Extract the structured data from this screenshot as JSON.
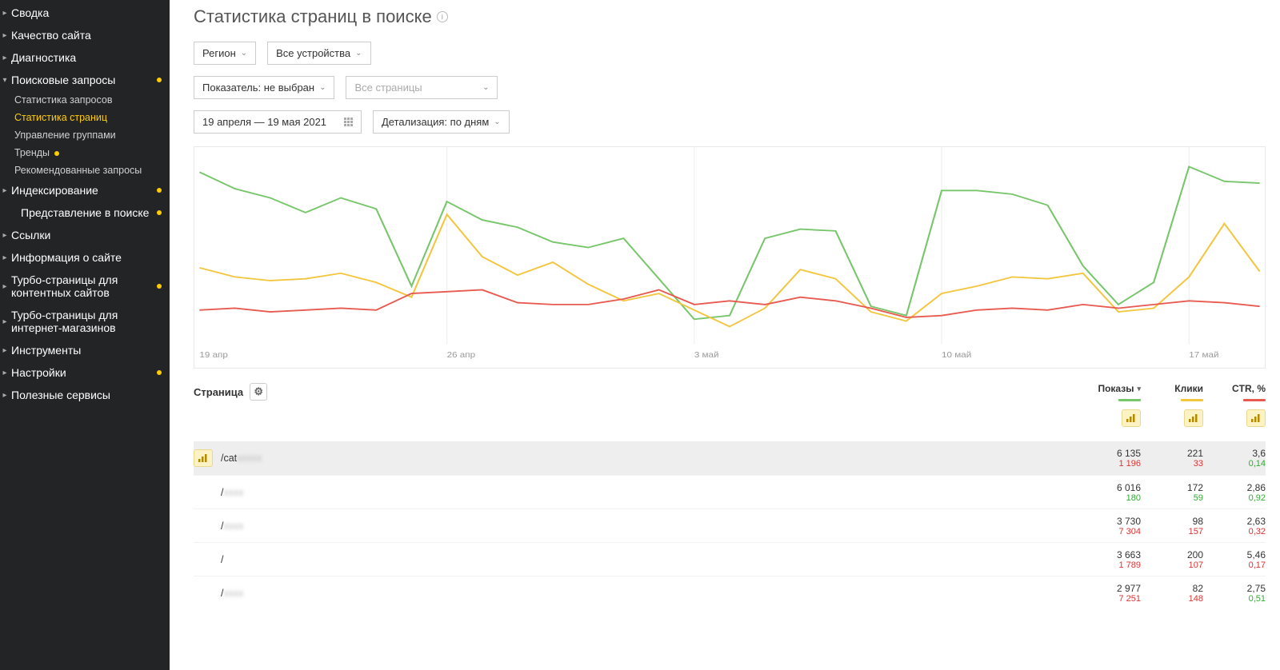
{
  "sidebar": {
    "items": [
      {
        "label": "Сводка",
        "caret": true
      },
      {
        "label": "Качество сайта",
        "caret": true
      },
      {
        "label": "Диагностика",
        "caret": true
      },
      {
        "label": "Поисковые запросы",
        "caret": true,
        "dot": true,
        "expanded": true,
        "children": [
          {
            "label": "Статистика запросов"
          },
          {
            "label": "Статистика страниц",
            "active": true
          },
          {
            "label": "Управление группами"
          },
          {
            "label": "Тренды",
            "dot": true
          },
          {
            "label": "Рекомендованные запросы"
          }
        ]
      },
      {
        "label": "Индексирование",
        "caret": true,
        "dot": true
      },
      {
        "label": "Представление в поиске",
        "caret": false,
        "dot": true,
        "indent": true
      },
      {
        "label": "Ссылки",
        "caret": true
      },
      {
        "label": "Информация о сайте",
        "caret": true
      },
      {
        "label": "Турбо-страницы для контентных сайтов",
        "caret": true,
        "dot": true
      },
      {
        "label": "Турбо-страницы для интернет-магазинов",
        "caret": true
      },
      {
        "label": "Инструменты",
        "caret": true
      },
      {
        "label": "Настройки",
        "caret": true,
        "dot": true
      },
      {
        "label": "Полезные сервисы",
        "caret": true
      }
    ]
  },
  "header": {
    "title": "Статистика страниц в поиске"
  },
  "controls": {
    "region": "Регион",
    "devices": "Все устройства",
    "metric": "Показатель: не выбран",
    "pages": "Все страницы",
    "date_range": "19 апреля — 19 мая 2021",
    "detail": "Детализация: по дням"
  },
  "chart_data": {
    "type": "line",
    "x_ticks": [
      "19 апр",
      "26 апр",
      "3 май",
      "10 май",
      "17 май"
    ],
    "x": [
      0,
      1,
      2,
      3,
      4,
      5,
      6,
      7,
      8,
      9,
      10,
      11,
      12,
      13,
      14,
      15,
      16,
      17,
      18,
      19,
      20,
      21,
      22,
      23,
      24,
      25,
      26,
      27,
      28,
      29,
      30
    ],
    "series": [
      {
        "name": "Показы",
        "color": "#78c66b",
        "values": [
          92,
          83,
          78,
          70,
          78,
          72,
          30,
          76,
          66,
          62,
          54,
          51,
          56,
          34,
          12,
          14,
          56,
          61,
          60,
          19,
          14,
          82,
          82,
          80,
          74,
          41,
          20,
          32,
          95,
          87,
          86
        ]
      },
      {
        "name": "Клики",
        "color": "#f3c63f",
        "values": [
          40,
          35,
          33,
          34,
          37,
          32,
          24,
          69,
          46,
          36,
          43,
          31,
          22,
          26,
          17,
          8,
          18,
          39,
          34,
          16,
          11,
          26,
          30,
          35,
          34,
          37,
          16,
          18,
          35,
          64,
          38
        ]
      },
      {
        "name": "CTR, %",
        "color": "#e85a4f",
        "values": [
          17,
          18,
          16,
          17,
          18,
          17,
          26,
          27,
          28,
          21,
          20,
          20,
          23,
          28,
          20,
          22,
          20,
          24,
          22,
          18,
          13,
          14,
          17,
          18,
          17,
          20,
          18,
          20,
          22,
          21,
          19
        ]
      }
    ],
    "y_range": [
      0,
      100
    ]
  },
  "table": {
    "header": {
      "page": "Страница",
      "cols": [
        {
          "label": "Показы",
          "sort": true,
          "underline": "#78c66b"
        },
        {
          "label": "Клики",
          "underline": "#f3c63f"
        },
        {
          "label": "CTR, %",
          "underline": "#e85a4f"
        }
      ]
    },
    "rows": [
      {
        "highlight": true,
        "url_prefix": "/cat",
        "url_blur": "xxxxx",
        "metrics": [
          {
            "main": "6 135",
            "delta": "1 196",
            "dir": "neg"
          },
          {
            "main": "221",
            "delta": "33",
            "dir": "neg"
          },
          {
            "main": "3,6",
            "delta": "0,14",
            "dir": "pos"
          }
        ]
      },
      {
        "url_prefix": "/",
        "url_blur": "xxxx",
        "metrics": [
          {
            "main": "6 016",
            "delta": "180",
            "dir": "pos"
          },
          {
            "main": "172",
            "delta": "59",
            "dir": "pos"
          },
          {
            "main": "2,86",
            "delta": "0,92",
            "dir": "pos"
          }
        ]
      },
      {
        "url_prefix": "/",
        "url_blur": "xxxx",
        "metrics": [
          {
            "main": "3 730",
            "delta": "7 304",
            "dir": "neg"
          },
          {
            "main": "98",
            "delta": "157",
            "dir": "neg"
          },
          {
            "main": "2,63",
            "delta": "0,32",
            "dir": "neg"
          }
        ]
      },
      {
        "url_prefix": "/",
        "url_blur": "",
        "metrics": [
          {
            "main": "3 663",
            "delta": "1 789",
            "dir": "neg"
          },
          {
            "main": "200",
            "delta": "107",
            "dir": "neg"
          },
          {
            "main": "5,46",
            "delta": "0,17",
            "dir": "neg"
          }
        ]
      },
      {
        "url_prefix": "/",
        "url_blur": "xxxx",
        "metrics": [
          {
            "main": "2 977",
            "delta": "7 251",
            "dir": "neg"
          },
          {
            "main": "82",
            "delta": "148",
            "dir": "neg"
          },
          {
            "main": "2,75",
            "delta": "0,51",
            "dir": "pos"
          }
        ]
      }
    ]
  }
}
